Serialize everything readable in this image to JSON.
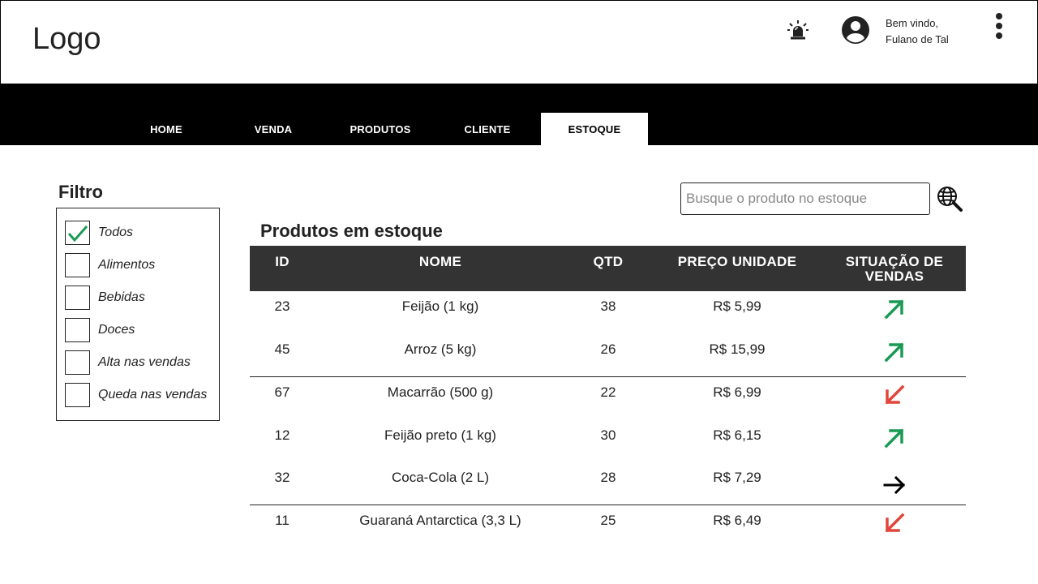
{
  "header": {
    "logo": "Logo",
    "welcome_line1": "Bem vindo,",
    "welcome_line2": "Fulano de Tal",
    "icons": [
      "alarm-icon",
      "user-avatar-icon",
      "more-vertical-icon"
    ]
  },
  "nav": {
    "tabs": [
      {
        "label": "HOME",
        "active": false
      },
      {
        "label": "VENDA",
        "active": false
      },
      {
        "label": "PRODUTOS",
        "active": false
      },
      {
        "label": "CLIENTE",
        "active": false
      },
      {
        "label": "ESTOQUE",
        "active": true
      }
    ]
  },
  "filter": {
    "title": "Filtro",
    "options": [
      {
        "label": "Todos",
        "checked": true
      },
      {
        "label": "Alimentos",
        "checked": false
      },
      {
        "label": "Bebidas",
        "checked": false
      },
      {
        "label": "Doces",
        "checked": false
      },
      {
        "label": "Alta nas vendas",
        "checked": false
      },
      {
        "label": "Queda nas vendas",
        "checked": false
      }
    ]
  },
  "search": {
    "placeholder": "Busque o produto no estoque",
    "value": ""
  },
  "table": {
    "title": "Produtos em estoque",
    "columns": [
      "ID",
      "NOME",
      "QTD",
      "PREÇO UNIDADE",
      "SITUAÇÃO DE VENDAS"
    ],
    "rows": [
      {
        "id": "23",
        "name": "Feijão (1 kg)",
        "qtd": "38",
        "price": "R$ 5,99",
        "trend": "up"
      },
      {
        "id": "45",
        "name": "Arroz (5 kg)",
        "qtd": "26",
        "price": "R$ 15,99",
        "trend": "up"
      },
      {
        "id": "67",
        "name": "Macarrão (500 g)",
        "qtd": "22",
        "price": "R$ 6,99",
        "trend": "down"
      },
      {
        "id": "12",
        "name": "Feijão preto (1 kg)",
        "qtd": "30",
        "price": "R$ 6,15",
        "trend": "up"
      },
      {
        "id": "32",
        "name": "Coca-Cola (2 L)",
        "qtd": "28",
        "price": "R$ 7,29",
        "trend": "stable"
      },
      {
        "id": "11",
        "name": "Guaraná Antarctica (3,3 L)",
        "qtd": "25",
        "price": "R$ 6,49",
        "trend": "down"
      }
    ]
  },
  "colors": {
    "trend_up": "#1a9a55",
    "trend_down": "#e0463a",
    "trend_stable": "#000000",
    "checkmark": "#1a9a55",
    "table_header": "#333333",
    "nav_background": "#000000"
  }
}
